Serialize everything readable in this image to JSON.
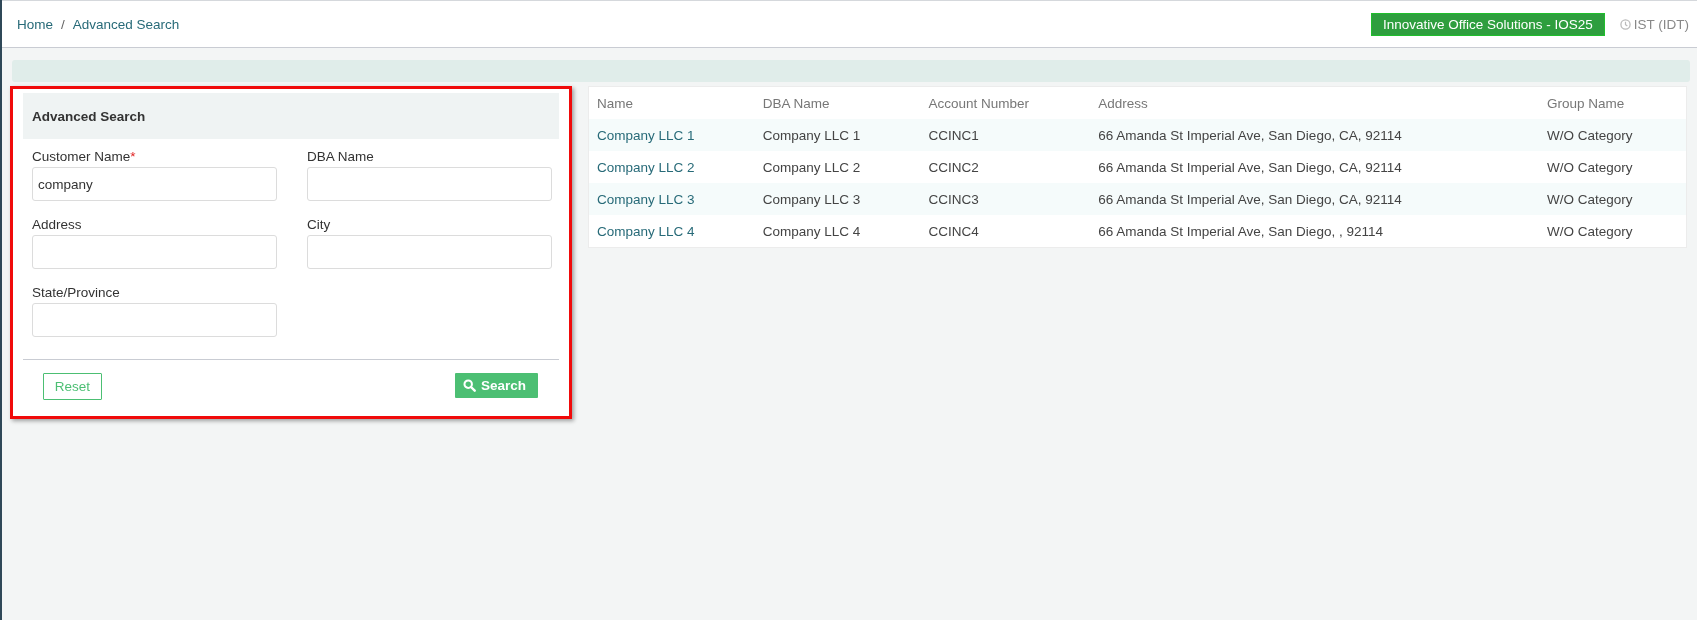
{
  "breadcrumb": [
    {
      "label": "Home"
    },
    {
      "label": "Advanced Search"
    }
  ],
  "breadcrumb_separator": "/",
  "company_badge": "Innovative Office Solutions - IOS25",
  "timezone": "IST (IDT)",
  "search_panel": {
    "title": "Advanced Search",
    "highlighted": true,
    "fields": [
      {
        "label": "Customer Name",
        "required_mark": "*",
        "value": "company"
      },
      {
        "label": "DBA Name"
      },
      {
        "label": "Address"
      },
      {
        "label": "City"
      },
      {
        "label": "State/Province"
      }
    ],
    "reset_button": "Reset",
    "search_button": "Search"
  },
  "table": {
    "columns": [
      "Name",
      "DBA Name",
      "Account Number",
      "Address",
      "Group Name"
    ],
    "rows": [
      [
        "Company LLC 1",
        "Company LLC 1",
        "CCINC1",
        "66 Amanda St Imperial Ave, San Diego, CA, 92114",
        "W/O Category"
      ],
      [
        "Company LLC 2",
        "Company LLC 2",
        "CCINC2",
        "66 Amanda St Imperial Ave, San Diego, CA, 92114",
        "W/O Category"
      ],
      [
        "Company LLC 3",
        "Company LLC 3",
        "CCINC3",
        "66 Amanda St Imperial Ave, San Diego, CA, 92114",
        "W/O Category"
      ],
      [
        "Company LLC 4",
        "Company LLC 4",
        "CCINC4",
        "66 Amanda St Imperial Ave, San Diego, , 92114",
        "W/O Category"
      ]
    ]
  }
}
